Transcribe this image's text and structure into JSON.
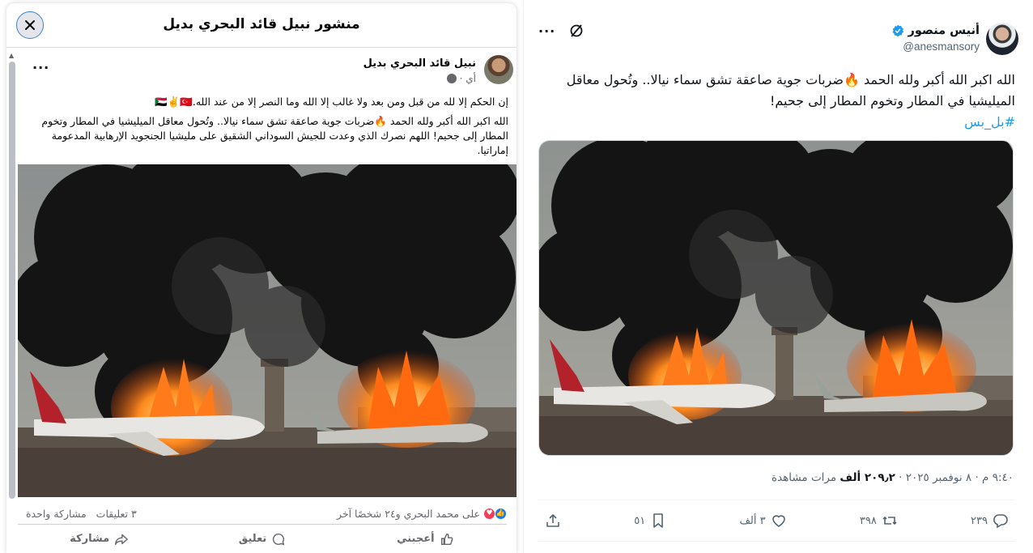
{
  "facebook": {
    "modal_title": "منشور نبيل قائد البحري بديل",
    "author": "نبيل قائد البحري بديل",
    "time": "أي ·",
    "paragraph1": "إن الحكم إلا لله من قبل ومن بعد ولا غالب إلا الله وما النصر إلا من عند الله.🇸🇩✌️🇹🇷",
    "paragraph2": "الله اكبر الله أكبر ولله الحمد 🔥ضربات جوية صاعقة تشق سماء نيالا.. وتُحول معاقل الميليشيا في المطار وتخوم المطار إلى جحيم! اللهم نصرك الذي وعدت للجيش السوداني الشقيق على مليشيا الجنجويد الإرهابية المدعومة إماراتيا.",
    "reactions_text": "علی محمد البحري و٢٤ شخصًا آخر",
    "comments_count": "٣ تعليقات",
    "shares_count": "مشاركة واحدة",
    "action_like": "أعجبني",
    "action_comment": "تعليق",
    "action_share": "مشاركة"
  },
  "twitter": {
    "display_name": "أنيس منصور",
    "handle": "@anesmansory",
    "text": "الله اكبر الله أكبر ولله الحمد 🔥ضربات جوية صاعقة تشق سماء نيالا.. وتُحول معاقل الميليشيا في المطار وتخوم المطار إلى جحيم!",
    "hashtag": "#بل_بس",
    "timestamp": "٩:٤٠ م · ٨ نوفمبر ٢٠٢٥ · ",
    "views_count": "٢٠٩٫٢ ألف",
    "views_label": " مرات مشاهدة",
    "replies": "٢٣٩",
    "reposts": "٣٩٨",
    "likes": "٣ ألف",
    "bookmarks": "٥١"
  },
  "colors": {
    "link_blue": "#1d9bf0",
    "fb_blue": "#1877f2",
    "text_dark": "#0f1419",
    "muted": "#536471"
  }
}
